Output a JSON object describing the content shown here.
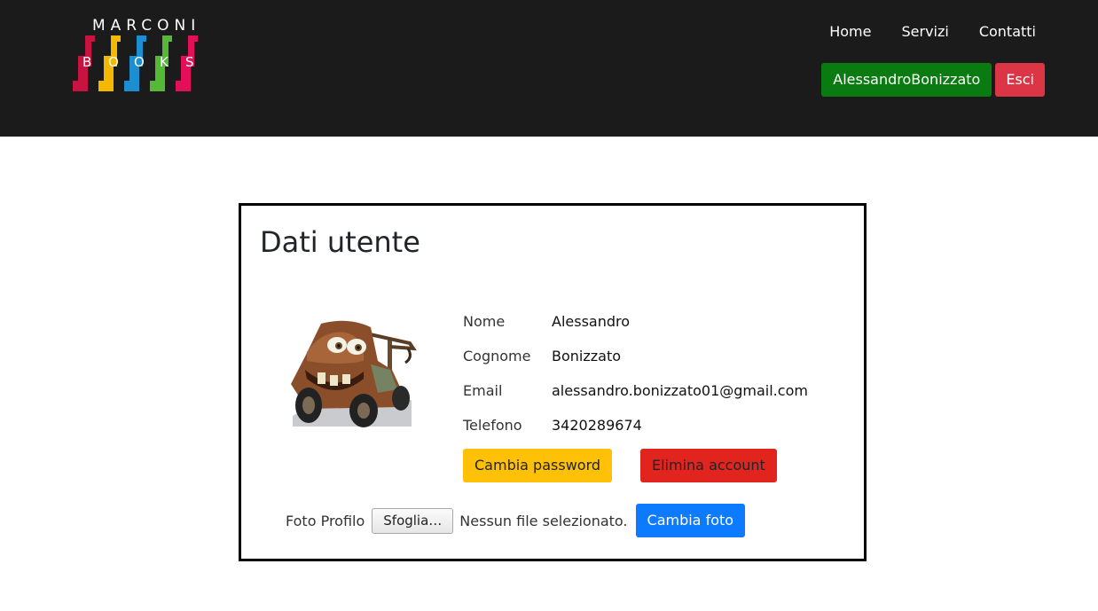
{
  "navbar": {
    "logo": {
      "top_text": "MARCONI",
      "bottom_letters": [
        "B",
        "O",
        "O",
        "K",
        "S"
      ],
      "colors": [
        "#c8123f",
        "#f5b800",
        "#1c8fd0",
        "#55b837",
        "#e30f58"
      ]
    },
    "links": [
      {
        "label": "Home"
      },
      {
        "label": "Servizi"
      },
      {
        "label": "Contatti"
      }
    ],
    "user_button": "AlessandroBonizzato",
    "logout_button": "Esci"
  },
  "profile": {
    "title": "Dati utente",
    "avatar_icon": "tow-truck-avatar",
    "fields": [
      {
        "label": "Nome",
        "value": "Alessandro"
      },
      {
        "label": "Cognome",
        "value": "Bonizzato"
      },
      {
        "label": "Email",
        "value": "alessandro.bonizzato01@gmail.com"
      },
      {
        "label": "Telefono",
        "value": "3420289674"
      }
    ],
    "change_password_button": "Cambia password",
    "delete_account_button": "Elimina account",
    "photo": {
      "label": "Foto Profilo",
      "browse_button": "Sfoglia…",
      "status": "Nessun file selezionato.",
      "submit_button": "Cambia foto"
    }
  },
  "colors": {
    "navbar_bg": "#1b1b1b",
    "user_button": "#0a7b10",
    "logout_button": "#dc3545",
    "change_password": "#ffc107",
    "delete_account": "#e2241f",
    "change_photo": "#0d7bff"
  }
}
